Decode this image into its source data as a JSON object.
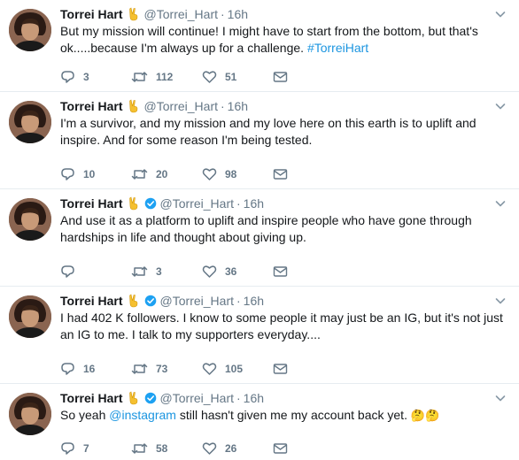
{
  "accent": "#1b95e0",
  "verified_color": "#1da1f2",
  "icons": {
    "reply": "reply-icon",
    "retweet": "retweet-icon",
    "like": "like-icon",
    "dm": "envelope-icon",
    "more": "chevron-down-icon",
    "badge": "victory-hand-emoji",
    "verified": "verified-badge-icon"
  },
  "tweets": [
    {
      "name": "Torrei Hart",
      "handle": "@Torrei_Hart",
      "sep": "·",
      "time": "16h",
      "verified": false,
      "text": "But my mission will continue! I might have to start from the bottom, but that's ok.....because I'm always up for a challenge. ",
      "hashtag": "#TorreiHart",
      "emoji": "",
      "replies": "3",
      "retweets": "112",
      "likes": "51"
    },
    {
      "name": "Torrei Hart",
      "handle": "@Torrei_Hart",
      "sep": "·",
      "time": "16h",
      "verified": false,
      "text": "I'm a survivor, and my mission and my love here on this earth is to uplift and inspire. And for some reason I'm being tested.",
      "replies": "10",
      "retweets": "20",
      "likes": "98"
    },
    {
      "name": "Torrei Hart",
      "handle": "@Torrei_Hart",
      "sep": "·",
      "time": "16h",
      "verified": true,
      "text": "And use it as a platform to uplift and inspire people who have gone through hardships in life and thought about giving up.",
      "replies": "",
      "retweets": "3",
      "likes": "36"
    },
    {
      "name": "Torrei Hart",
      "handle": "@Torrei_Hart",
      "sep": "·",
      "time": "16h",
      "verified": true,
      "text": "I had 402 K followers. I know to some people it may just be an IG, but it's not just an IG to me. I talk to my supporters everyday....",
      "replies": "16",
      "retweets": "73",
      "likes": "105"
    },
    {
      "name": "Torrei Hart",
      "handle": "@Torrei_Hart",
      "sep": "·",
      "time": "16h",
      "verified": true,
      "text_before": "So yeah ",
      "mention": "@instagram",
      "text_after": " still hasn't given me my account back yet. ",
      "emoji": "🤔🤔",
      "replies": "7",
      "retweets": "58",
      "likes": "26"
    }
  ]
}
